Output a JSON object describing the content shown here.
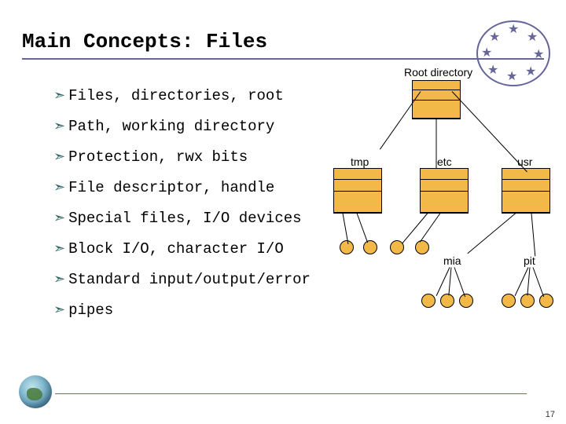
{
  "title": "Main Concepts: Files",
  "bullets": [
    "Files, directories, root",
    "Path, working directory",
    "Protection, rwx bits",
    "File descriptor, handle",
    "Special files, I/O devices",
    "Block I/O, character I/O",
    "Standard input/output/error",
    "pipes"
  ],
  "diagram": {
    "root_label": "Root directory",
    "tmp_label": "tmp",
    "etc_label": "etc",
    "usr_label": "usr",
    "mia_label": "mia",
    "pit_label": "pit"
  },
  "page_number": "17"
}
